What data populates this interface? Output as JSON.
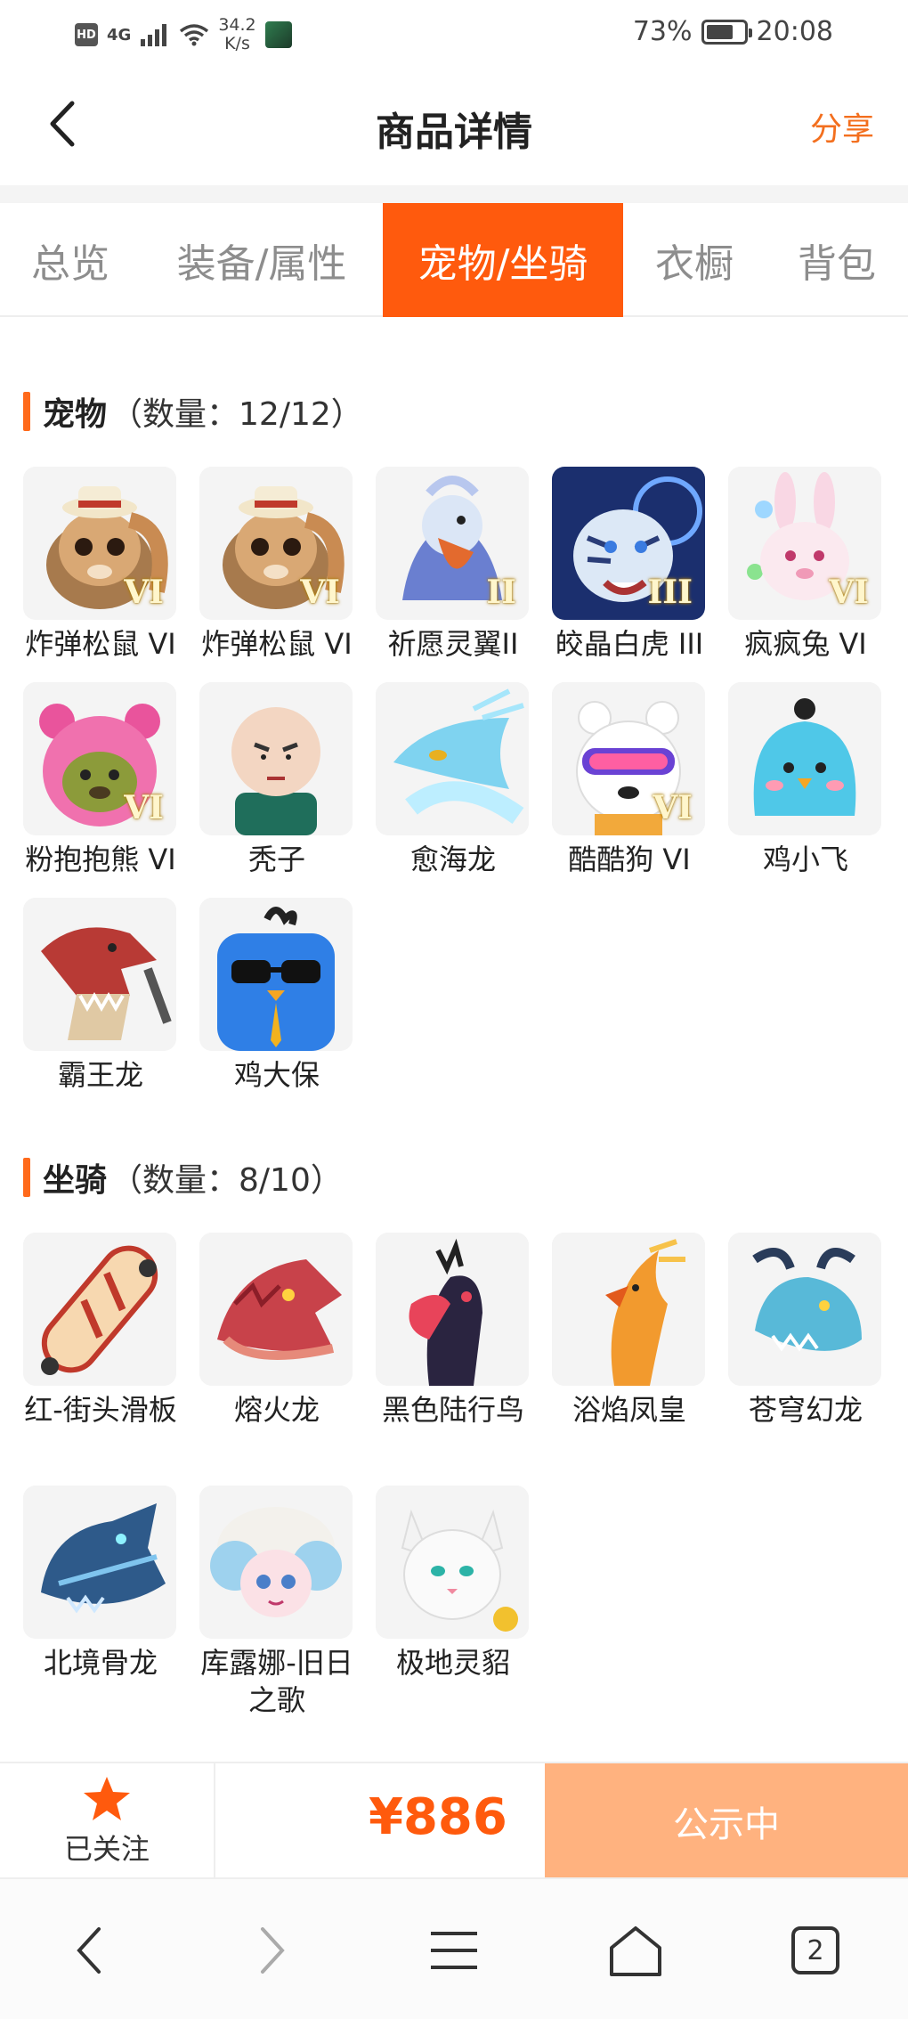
{
  "status_bar": {
    "hd": "HD",
    "network": "4G",
    "speed_value": "34.2",
    "speed_unit": "K/s",
    "battery_text": "73%",
    "battery_level": 0.73,
    "time": "20:08"
  },
  "header": {
    "title": "商品详情",
    "share_label": "分享"
  },
  "tabs": [
    {
      "label": "总览",
      "active": false
    },
    {
      "label": "装备/属性",
      "active": false
    },
    {
      "label": "宠物/坐骑",
      "active": true
    },
    {
      "label": "衣橱",
      "active": false
    },
    {
      "label": "背包",
      "active": false
    }
  ],
  "pets": {
    "title": "宠物",
    "count": "（数量：12/12）",
    "items": [
      {
        "name": "炸弹松鼠 VI",
        "grade": "VI",
        "icon": "bomb-squirrel-icon"
      },
      {
        "name": "炸弹松鼠 VI",
        "grade": "VI",
        "icon": "bomb-squirrel-icon"
      },
      {
        "name": "祈愿灵翼II",
        "grade": "II",
        "icon": "wish-wing-bird-icon"
      },
      {
        "name": "皎晶白虎 III",
        "grade": "III",
        "icon": "crystal-white-tiger-icon"
      },
      {
        "name": "疯疯兔 VI",
        "grade": "VI",
        "icon": "crazy-rabbit-icon"
      },
      {
        "name": "粉抱抱熊 VI",
        "grade": "VI",
        "icon": "pink-hug-bear-icon"
      },
      {
        "name": "秃子",
        "grade": "",
        "icon": "bald-kid-icon"
      },
      {
        "name": "愈海龙",
        "grade": "",
        "icon": "sea-dragon-icon"
      },
      {
        "name": "酷酷狗 VI",
        "grade": "VI",
        "icon": "cool-dog-icon"
      },
      {
        "name": "鸡小飞",
        "grade": "",
        "icon": "little-chick-icon"
      },
      {
        "name": "霸王龙",
        "grade": "",
        "icon": "t-rex-icon"
      },
      {
        "name": "鸡大保",
        "grade": "",
        "icon": "blue-chick-sunglasses-icon"
      }
    ]
  },
  "mounts": {
    "title": "坐骑",
    "count": "（数量：8/10）",
    "items": [
      {
        "name": "红-街头滑板",
        "icon": "skateboard-icon"
      },
      {
        "name": "熔火龙",
        "icon": "lava-dragon-icon"
      },
      {
        "name": "黑色陆行鸟",
        "icon": "black-chocobo-icon"
      },
      {
        "name": "浴焰凤皇",
        "icon": "flame-phoenix-icon"
      },
      {
        "name": "苍穹幻龙",
        "icon": "sky-dragon-icon"
      },
      {
        "name": "北境骨龙",
        "icon": "bone-dragon-icon"
      },
      {
        "name": "库露娜-旧日之歌",
        "icon": "kuluna-icon"
      },
      {
        "name": "极地灵貂",
        "icon": "polar-ferret-icon"
      }
    ]
  },
  "action_bar": {
    "follow_label": "已关注",
    "price": "¥886",
    "status_button": "公示中"
  },
  "nav": {
    "tab_count": "2"
  },
  "colors": {
    "accent": "#ff5a0d",
    "cta": "#ffb27f",
    "muted_tab": "#8d8d8d"
  }
}
